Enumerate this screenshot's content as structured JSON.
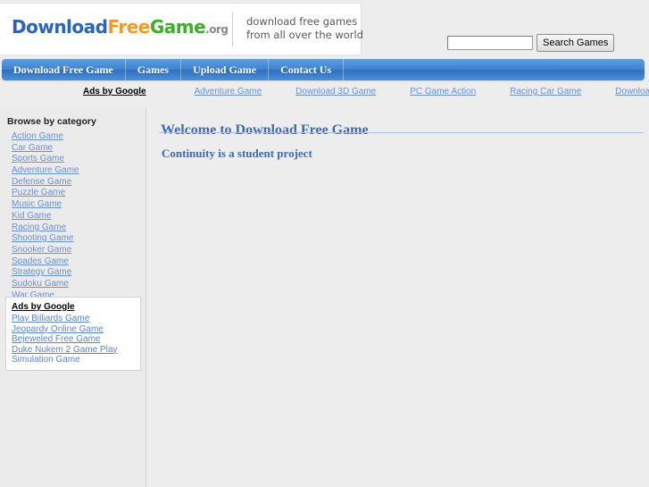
{
  "header": {
    "logo": {
      "part1": "Download",
      "part2": "Free",
      "part3": "Game",
      "part4": ".org"
    },
    "tagline_line1": "download free games",
    "tagline_line2": "from all over the world"
  },
  "search": {
    "value": "",
    "placeholder": "",
    "button_label": "Search Games"
  },
  "nav": {
    "items": [
      {
        "label": "Download Free Game"
      },
      {
        "label": "Games"
      },
      {
        "label": "Upload Game"
      },
      {
        "label": "Contact Us"
      }
    ]
  },
  "ads_top": {
    "label": "Ads by Google",
    "links": [
      {
        "label": "Adventure Game"
      },
      {
        "label": "Download 3D Game"
      },
      {
        "label": "PC Game Action"
      },
      {
        "label": "Racing Car Game"
      },
      {
        "label": "Download Free Pacman"
      }
    ]
  },
  "sidebar": {
    "browse_title": "Browse by category",
    "categories": [
      {
        "label": "Action Game"
      },
      {
        "label": "Car Game"
      },
      {
        "label": "Sports Game"
      },
      {
        "label": "Adventure Game"
      },
      {
        "label": "Defense Game"
      },
      {
        "label": "Puzzle Game"
      },
      {
        "label": "Music Game"
      },
      {
        "label": "Kid Game"
      },
      {
        "label": "Racing Game"
      },
      {
        "label": "Shooting Game"
      },
      {
        "label": "Snooker Game"
      },
      {
        "label": "Spades Game"
      },
      {
        "label": "Strategy Game"
      },
      {
        "label": "Sudoku Game"
      },
      {
        "label": "War Game"
      }
    ],
    "ads": {
      "label": "Ads by Google",
      "links": [
        {
          "label": "Play Billiards Game"
        },
        {
          "label": "Jeopardy Online Game"
        },
        {
          "label": "Bejeweled Free Game"
        },
        {
          "label": "Duke Nukem 2 Game Play"
        },
        {
          "label": "Simulation Game"
        }
      ]
    }
  },
  "main": {
    "title": "Welcome to Download Free Game",
    "subtitle": "Continuity is a student project"
  },
  "colors": {
    "logo_blue": "#2a62c4",
    "logo_orange": "#f59a20",
    "logo_green": "#3fae2a",
    "logo_gray": "#8a8a8a",
    "nav_blue": "#3f82cf",
    "link_blue": "#6b8fd4",
    "heading_blue": "#3d6bb5",
    "page_bg": "#ededed",
    "sidebar_bg": "#ebebeb"
  }
}
